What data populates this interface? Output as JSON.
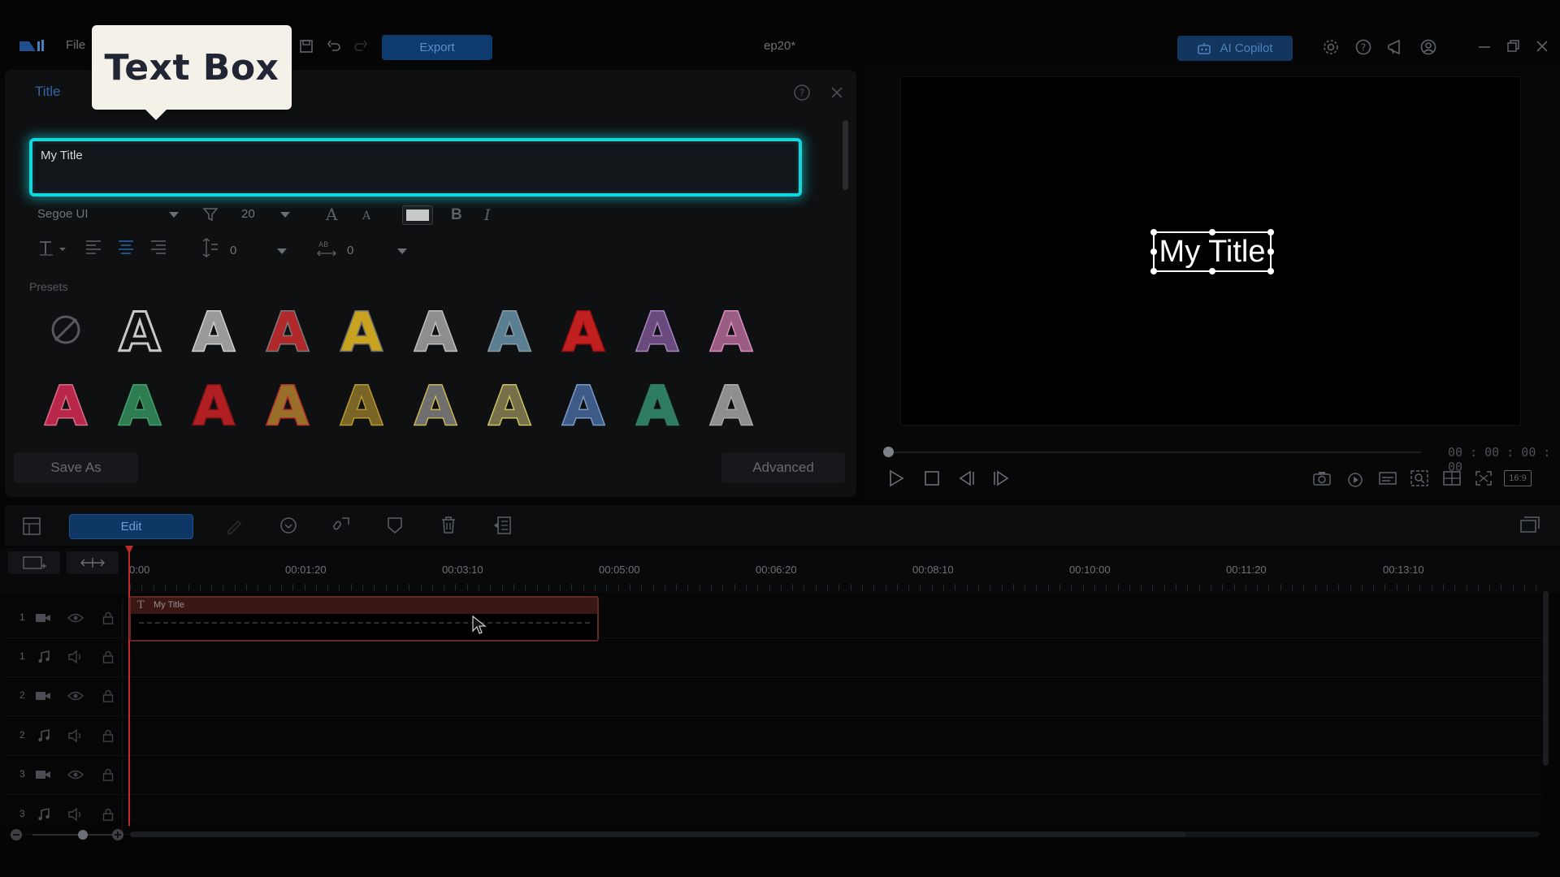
{
  "app": {
    "menu_file": "File",
    "export_label": "Export",
    "project_name": "ep20*",
    "ai_copilot_label": "AI Copilot"
  },
  "callout": {
    "text": "Text Box"
  },
  "title_panel": {
    "tab_label": "Title",
    "text_value": "My Title",
    "font_family": "Segoe UI",
    "font_size": "20",
    "line_spacing": "0",
    "char_spacing": "0",
    "presets_label": "Presets",
    "save_as_label": "Save As",
    "advanced_label": "Advanced",
    "presets": [
      {
        "style": "none"
      },
      {
        "fill": "transparent",
        "stroke": "#c8c8c8"
      },
      {
        "fill": "#9a9a9a",
        "stroke": "#d0d0d0"
      },
      {
        "fill": "#b0282a",
        "stroke": "#7a7a7a"
      },
      {
        "fill": "#c9a21f",
        "stroke": "#6d6d6d"
      },
      {
        "fill": "#8e8e8e",
        "stroke": "#bdbdbd"
      },
      {
        "fill": "#5a7f93",
        "stroke": "#8a9aa2"
      },
      {
        "fill": "#c0201f",
        "stroke": "#9a1010"
      },
      {
        "fill": "#6a4a7c",
        "stroke": "#a783bf"
      },
      {
        "fill": "#9b5c84",
        "stroke": "#d88fc0"
      },
      {
        "fill": "#b8274a",
        "stroke": "#d86d86"
      },
      {
        "fill": "#2f7c52",
        "stroke": "#3fa06a"
      },
      {
        "fill": "#b01f22",
        "stroke": "#7b1315"
      },
      {
        "fill": "#9a6f2a",
        "stroke": "#b2302c"
      },
      {
        "fill": "#7a6526",
        "stroke": "#b79a2f"
      },
      {
        "fill": "#6f6f6f",
        "stroke": "#c7b453"
      },
      {
        "fill": "#75704a",
        "stroke": "#c9c25f"
      },
      {
        "fill": "#3d5b86",
        "stroke": "#7a9ac6"
      },
      {
        "fill": "#2e7c63",
        "stroke": "#2e7c63"
      },
      {
        "fill": "#8e8e8e",
        "stroke": "#a9a9a9"
      }
    ]
  },
  "preview": {
    "title_text": "My Title",
    "timecode": "00 : 00 : 00 : 00",
    "aspect": "16:9",
    "progress": 0
  },
  "timeline": {
    "edit_label": "Edit",
    "ticks": [
      "0:00",
      "00:01:20",
      "00:03:10",
      "00:05:00",
      "00:06:20",
      "00:08:10",
      "00:10:00",
      "00:11:20",
      "00:13:10"
    ],
    "clip_label": "My Title",
    "track_numbers": [
      "1",
      "1",
      "2",
      "2",
      "3",
      "3"
    ]
  }
}
